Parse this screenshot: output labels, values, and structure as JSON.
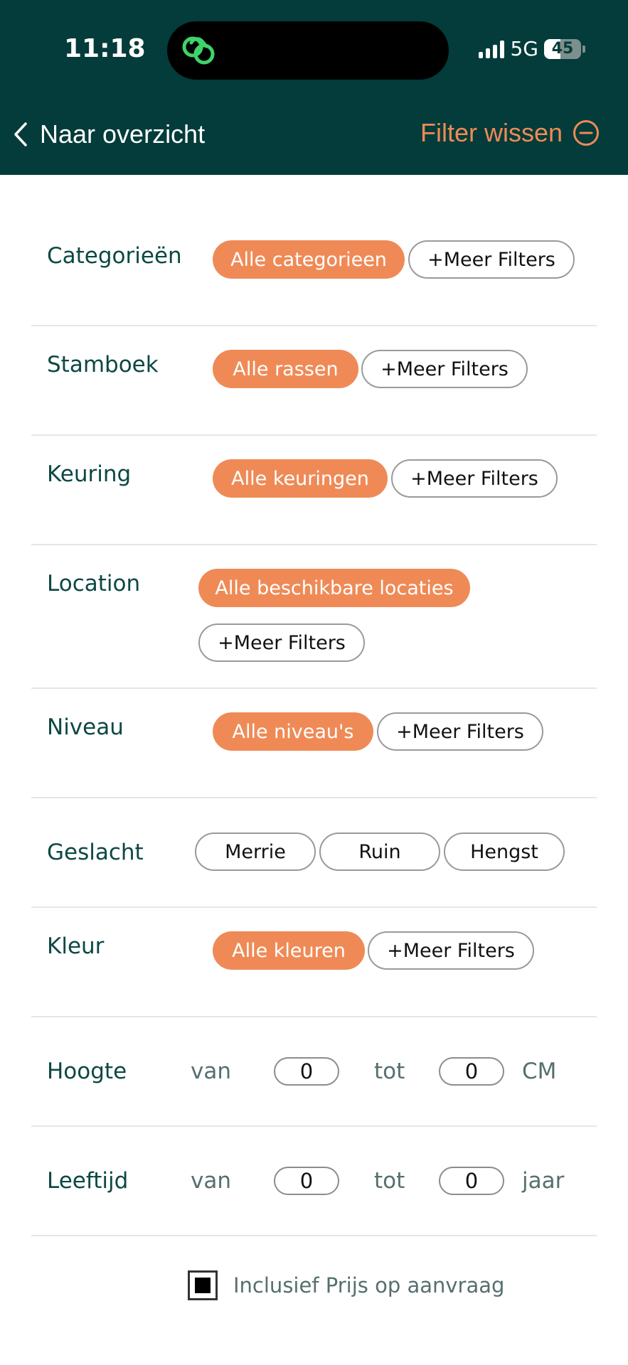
{
  "status_bar": {
    "time": "11:18",
    "network": "5G",
    "battery": "45",
    "battery_level": 0.45
  },
  "nav": {
    "back_label": "Naar overzicht",
    "clear_label": "Filter wissen"
  },
  "filters": {
    "categorieen": {
      "label": "Categorieën",
      "active": "Alle categorieen",
      "more": "+Meer Filters"
    },
    "stamboek": {
      "label": "Stamboek",
      "active": "Alle rassen",
      "more": "+Meer Filters"
    },
    "keuring": {
      "label": "Keuring",
      "active": "Alle keuringen",
      "more": "+Meer Filters"
    },
    "location": {
      "label": "Location",
      "active": "Alle beschikbare locaties",
      "more": "+Meer Filters"
    },
    "niveau": {
      "label": "Niveau",
      "active": "Alle niveau's",
      "more": "+Meer Filters"
    },
    "geslacht": {
      "label": "Geslacht",
      "options": [
        "Merrie",
        "Ruin",
        "Hengst"
      ]
    },
    "kleur": {
      "label": "Kleur",
      "active": "Alle kleuren",
      "more": "+Meer Filters"
    }
  },
  "hoogte": {
    "label": "Hoogte",
    "from_label": "van",
    "from_value": "0",
    "to_label": "tot",
    "to_value": "0",
    "unit": "CM"
  },
  "leeftijd": {
    "label": "Leeftijd",
    "from_label": "van",
    "from_value": "0",
    "to_label": "tot",
    "to_value": "0",
    "unit": "jaar"
  },
  "price_on_request": {
    "label": "Inclusief Prijs op aanvraag",
    "checked": true
  }
}
